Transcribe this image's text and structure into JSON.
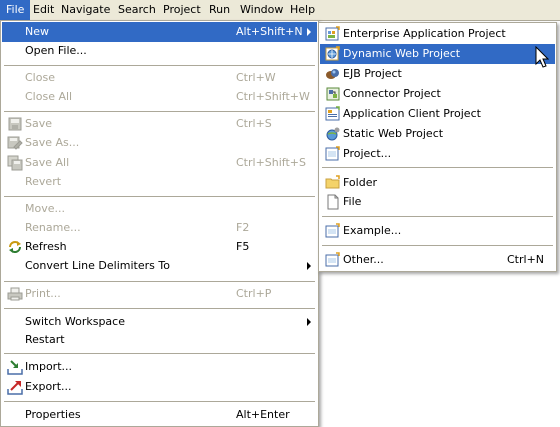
{
  "menubar": {
    "items": [
      "File",
      "Edit",
      "Navigate",
      "Search",
      "Project",
      "Run",
      "Window",
      "Help"
    ]
  },
  "file_menu": {
    "new": {
      "label": "New",
      "accel": "Alt+Shift+N"
    },
    "open_file": {
      "label": "Open File..."
    },
    "close": {
      "label": "Close",
      "accel": "Ctrl+W"
    },
    "close_all": {
      "label": "Close All",
      "accel": "Ctrl+Shift+W"
    },
    "save": {
      "label": "Save",
      "accel": "Ctrl+S"
    },
    "save_as": {
      "label": "Save As..."
    },
    "save_all": {
      "label": "Save All",
      "accel": "Ctrl+Shift+S"
    },
    "revert": {
      "label": "Revert"
    },
    "move": {
      "label": "Move..."
    },
    "rename": {
      "label": "Rename...",
      "accel": "F2"
    },
    "refresh": {
      "label": "Refresh",
      "accel": "F5"
    },
    "convert": {
      "label": "Convert Line Delimiters To"
    },
    "print": {
      "label": "Print...",
      "accel": "Ctrl+P"
    },
    "switch_workspace": {
      "label": "Switch Workspace"
    },
    "restart": {
      "label": "Restart"
    },
    "import": {
      "label": "Import..."
    },
    "export": {
      "label": "Export..."
    },
    "properties": {
      "label": "Properties",
      "accel": "Alt+Enter"
    }
  },
  "new_submenu": {
    "enterprise_app": {
      "label": "Enterprise Application Project"
    },
    "dynamic_web": {
      "label": "Dynamic Web Project"
    },
    "ejb": {
      "label": "EJB Project"
    },
    "connector": {
      "label": "Connector Project"
    },
    "app_client": {
      "label": "Application Client Project"
    },
    "static_web": {
      "label": "Static Web Project"
    },
    "project": {
      "label": "Project..."
    },
    "folder": {
      "label": "Folder"
    },
    "file": {
      "label": "File"
    },
    "example": {
      "label": "Example..."
    },
    "other": {
      "label": "Other...",
      "accel": "Ctrl+N"
    }
  },
  "colors": {
    "highlight": "#316AC5",
    "disabled": "#ACA899",
    "menubar": "#ECE9D8"
  }
}
